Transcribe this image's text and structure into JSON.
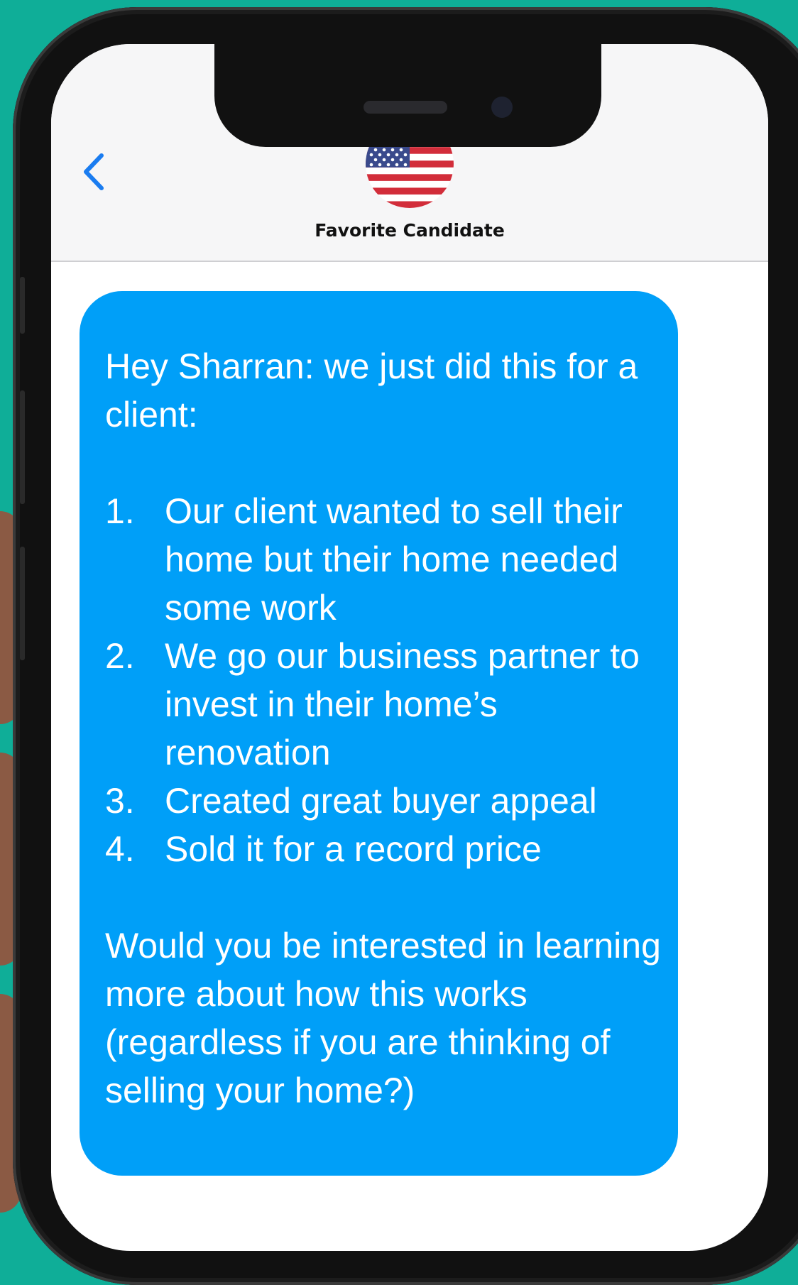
{
  "contact": {
    "name": "Favorite Candidate",
    "avatar_icon": "us-flag-icon"
  },
  "navigation": {
    "back_icon": "chevron-left-icon"
  },
  "colors": {
    "background": "#0fae98",
    "bubble": "#009ff8",
    "back_chevron": "#1a7cf0",
    "header": "#f6f6f7"
  },
  "message": {
    "intro": "Hey Sharran: we just did this for a client:",
    "items": [
      {
        "number": "1.",
        "text": "Our client wanted to sell their home but their home needed some work"
      },
      {
        "number": "2.",
        "text": "We go our business partner to invest in their home’s renovation"
      },
      {
        "number": "3.",
        "text": "Created great buyer appeal"
      },
      {
        "number": "4.",
        "text": "Sold it for a record price"
      }
    ],
    "closing": "Would you be interested in learning more about how this works (regardless if you are thinking of selling your home?)"
  }
}
